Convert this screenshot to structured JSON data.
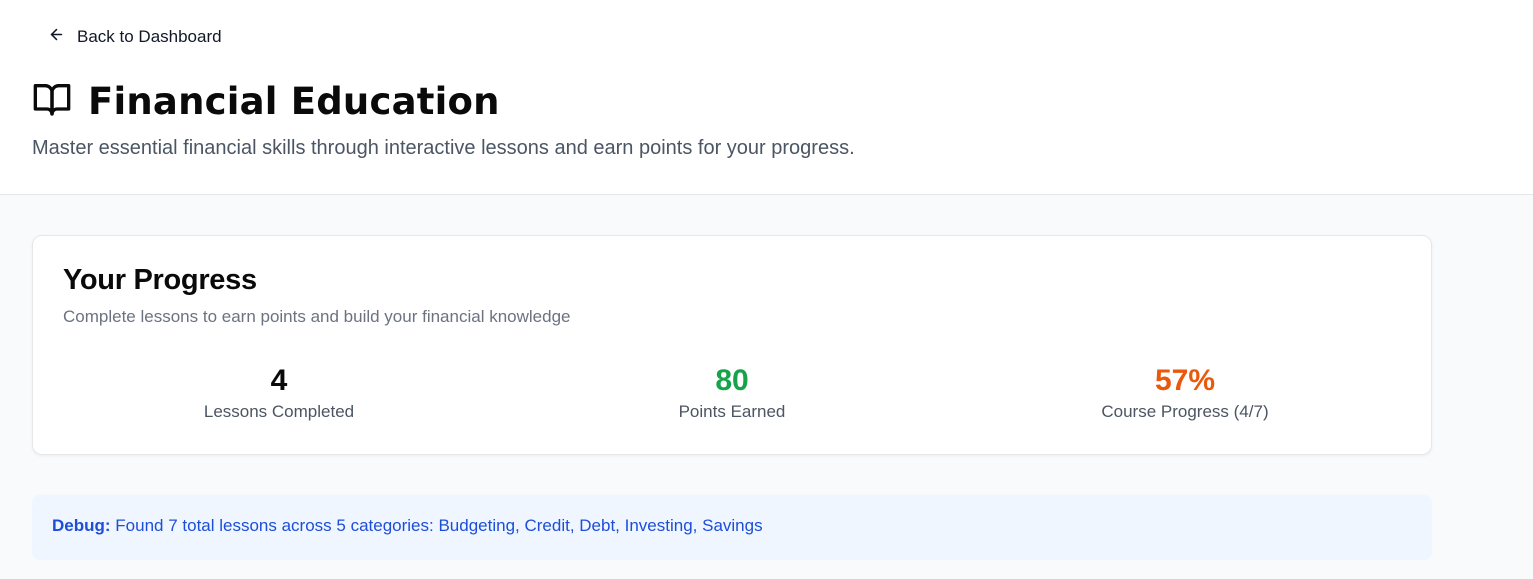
{
  "header": {
    "back_label": "Back to Dashboard",
    "title": "Financial Education",
    "subtitle": "Master essential financial skills through interactive lessons and earn points for your progress."
  },
  "progress": {
    "title": "Your Progress",
    "description": "Complete lessons to earn points and build your financial knowledge",
    "stats": [
      {
        "value": "4",
        "label": "Lessons Completed",
        "color": "#0a0a0a"
      },
      {
        "value": "80",
        "label": "Points Earned",
        "color": "#16a34a"
      },
      {
        "value": "57%",
        "label": "Course Progress (4/7)",
        "color": "#ea580c"
      }
    ]
  },
  "debug": {
    "prefix": "Debug:",
    "message": "Found 7 total lessons across 5 categories: Budgeting, Credit, Debt, Investing, Savings"
  },
  "icons": {
    "back": "arrow-left-icon",
    "title": "book-open-icon"
  }
}
